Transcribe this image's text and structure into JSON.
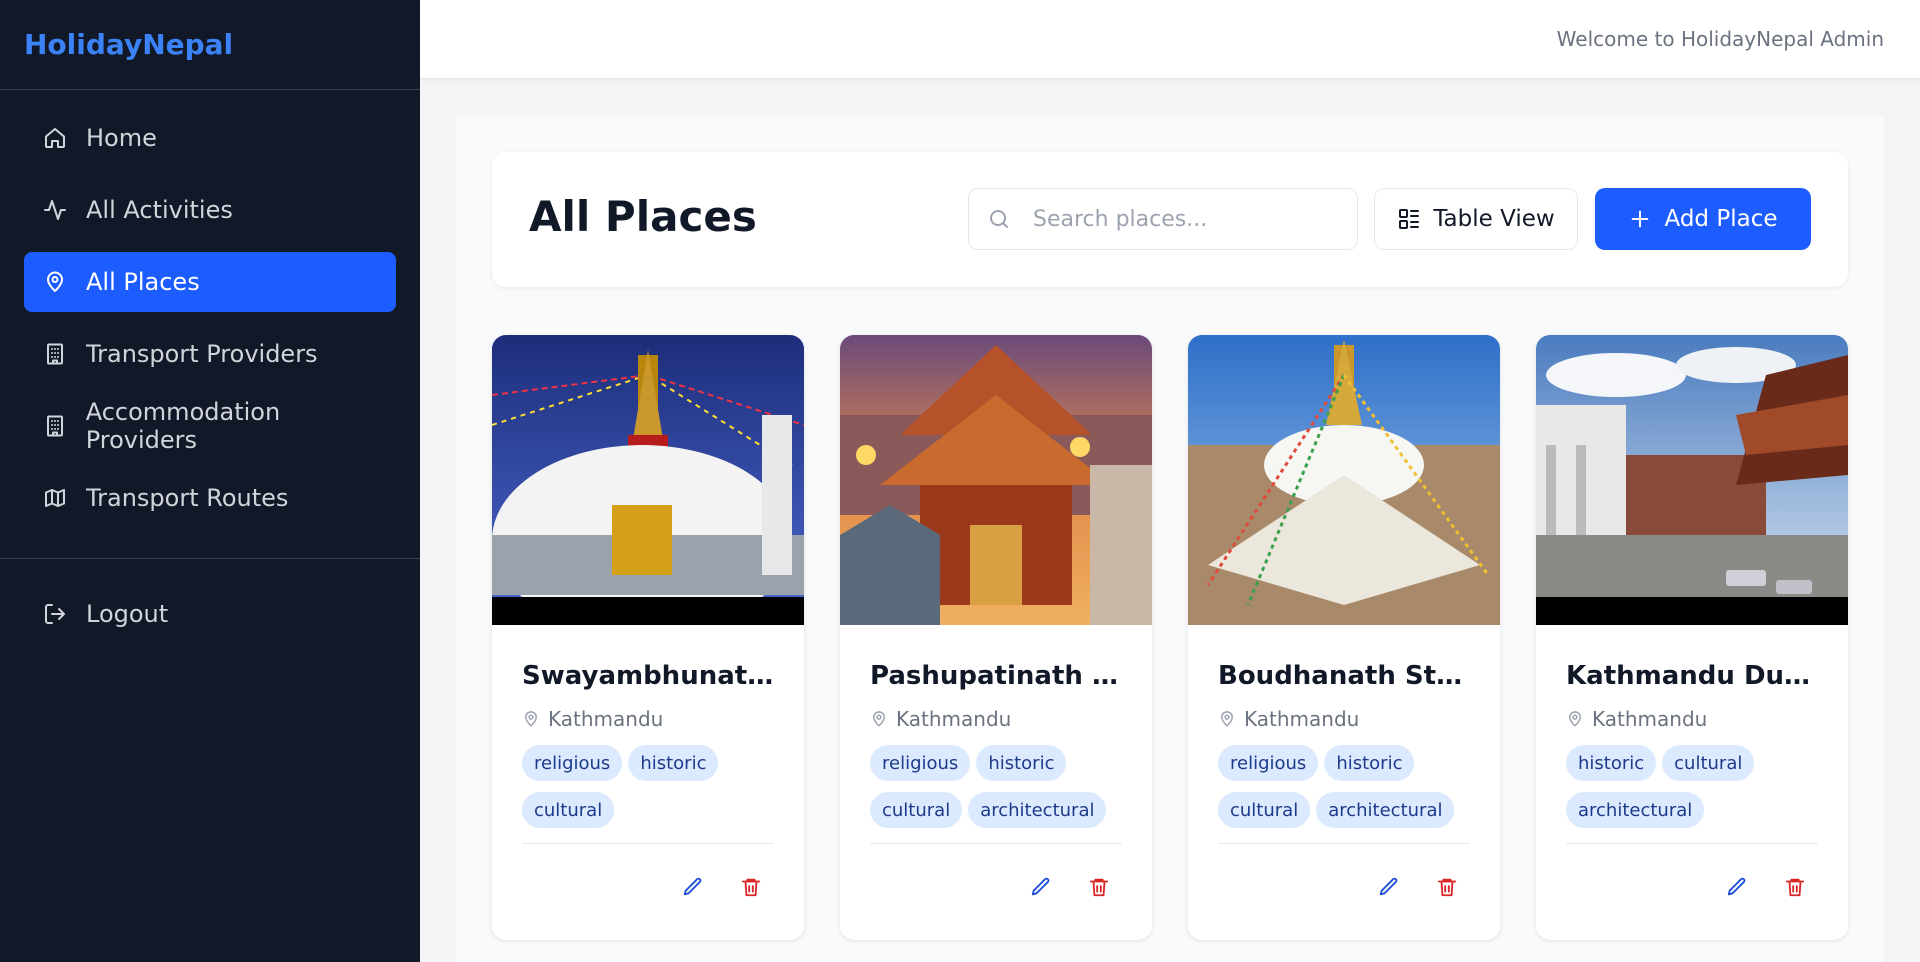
{
  "app": {
    "brand": "HolidayNepal"
  },
  "sidebar": {
    "items": [
      {
        "label": "Home",
        "icon": "home-icon",
        "active": false
      },
      {
        "label": "All Activities",
        "icon": "activity-icon",
        "active": false
      },
      {
        "label": "All Places",
        "icon": "map-pin-icon",
        "active": true
      },
      {
        "label": "Transport Providers",
        "icon": "building-icon",
        "active": false
      },
      {
        "label": "Accommodation Providers",
        "icon": "building-icon",
        "active": false
      },
      {
        "label": "Transport Routes",
        "icon": "map-icon",
        "active": false
      }
    ],
    "logout": {
      "label": "Logout",
      "icon": "logout-icon"
    }
  },
  "topbar": {
    "welcome": "Welcome to HolidayNepal Admin"
  },
  "main": {
    "title": "All Places",
    "search": {
      "placeholder": "Search places...",
      "value": ""
    },
    "view_toggle_label": "Table View",
    "add_label": "Add Place"
  },
  "places": [
    {
      "name": "Swayambhunath ...",
      "location": "Kathmandu",
      "tags": [
        "religious",
        "historic",
        "cultural"
      ]
    },
    {
      "name": "Pashupatinath Te...",
      "location": "Kathmandu",
      "tags": [
        "religious",
        "historic",
        "cultural",
        "architectural"
      ]
    },
    {
      "name": "Boudhanath Stupa",
      "location": "Kathmandu",
      "tags": [
        "religious",
        "historic",
        "cultural",
        "architectural"
      ]
    },
    {
      "name": "Kathmandu Durb...",
      "location": "Kathmandu",
      "tags": [
        "historic",
        "cultural",
        "architectural"
      ]
    }
  ],
  "colors": {
    "sidebar_bg": "#111827",
    "brand": "#3b82f6",
    "primary": "#1d5cff",
    "tag_bg": "#dbeafe",
    "tag_text": "#1e3a8a",
    "edit_icon": "#1d4ed8",
    "delete_icon": "#dc2626"
  }
}
